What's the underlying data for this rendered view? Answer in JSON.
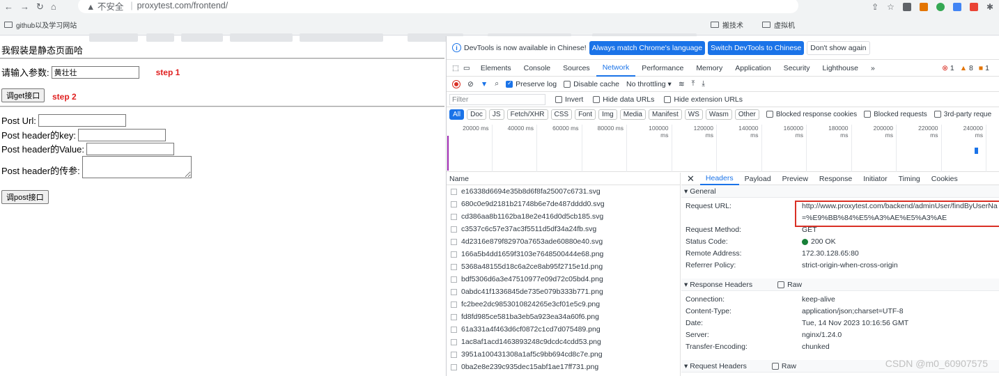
{
  "browser": {
    "address": {
      "security_label": "▲ 不安全",
      "url": "proxytest.com/frontend/"
    },
    "bookmarks": [
      {
        "label": "github以及学习网站"
      },
      {
        "label": "搬技术"
      },
      {
        "label": "虚拟机"
      }
    ]
  },
  "page": {
    "title": "我假装是静态页面哈",
    "param_label": "请输入参数:",
    "param_value": "黄壮壮",
    "step1": "step 1",
    "get_button": "调get接口",
    "step2": "step 2",
    "post_url_label": "Post Url:",
    "post_key_label": "Post header的key:",
    "post_value_label": "Post header的Value:",
    "post_param_label": "Post header的传参:",
    "post_button": "调post接口"
  },
  "devtools": {
    "infobar": {
      "text": "DevTools is now available in Chinese!",
      "btn_match": "Always match Chrome's language",
      "btn_switch": "Switch DevTools to Chinese",
      "btn_dismiss": "Don't show again"
    },
    "tabs": [
      "Elements",
      "Console",
      "Sources",
      "Network",
      "Performance",
      "Memory",
      "Application",
      "Security",
      "Lighthouse"
    ],
    "more_tabs": "»",
    "counts": {
      "errors": "1",
      "warnings": "8",
      "issues": "1"
    },
    "network_bar": {
      "preserve_log": "Preserve log",
      "disable_cache": "Disable cache",
      "throttling": "No throttling"
    },
    "filter": {
      "placeholder": "Filter",
      "invert": "Invert",
      "hide_data": "Hide data URLs",
      "hide_ext": "Hide extension URLs"
    },
    "types": [
      "All",
      "Doc",
      "JS",
      "Fetch/XHR",
      "CSS",
      "Font",
      "Img",
      "Media",
      "Manifest",
      "WS",
      "Wasm",
      "Other"
    ],
    "type_filters": [
      "Blocked response cookies",
      "Blocked requests",
      "3rd-party reque"
    ],
    "timeline_ticks": [
      "20000 ms",
      "40000 ms",
      "60000 ms",
      "80000 ms",
      "100000 ms",
      "120000 ms",
      "140000 ms",
      "160000 ms",
      "180000 ms",
      "200000 ms",
      "220000 ms",
      "240000 ms"
    ],
    "name_header": "Name",
    "files": [
      "e16338d6694e35b8d6f8fa25007c6731.svg",
      "680c0e9d2181b21748b6e7de487dddd0.svg",
      "cd386aa8b1162ba18e2e416d0d5cb185.svg",
      "c3537c6c57e37ac3f5511d5df34a24fb.svg",
      "4d2316e879f82970a7653ade60880e40.svg",
      "166a5b4dd1659f3103e7648500444e68.png",
      "5368a48155d18c6a2ce8ab95f2715e1d.png",
      "bdf5306d6a3e47510977e09d72c05bd4.png",
      "0abdc41f1336845de735e079b333b771.png",
      "fc2bee2dc9853010824265e3cf01e5c9.png",
      "fd8fd985ce581ba3eb5a923ea34a60f6.png",
      "61a331a4f463d6cf0872c1cd7d075489.png",
      "1ac8af1acd1463893248c9dcdc4cdd53.png",
      "3951a100431308a1af5c9bb694cd8c7e.png",
      "0ba2e8e239c935dec15abf1ae17ff731.png"
    ],
    "detail_tabs": [
      "Headers",
      "Payload",
      "Preview",
      "Response",
      "Initiator",
      "Timing",
      "Cookies"
    ],
    "general_title": "▾ General",
    "general": {
      "request_url_key": "Request URL:",
      "request_url_1": "http://www.proxytest.com/backend/adminUser/findByUserNa",
      "request_url_2": "=%E9%BB%84%E5%A3%AE%E5%A3%AE",
      "method_key": "Request Method:",
      "method": "GET",
      "status_key": "Status Code:",
      "status": "200 OK",
      "remote_key": "Remote Address:",
      "remote": "172.30.128.65:80",
      "referrer_key": "Referrer Policy:",
      "referrer": "strict-origin-when-cross-origin"
    },
    "response_headers_title": "▾ Response Headers",
    "raw_label": "Raw",
    "response_headers": [
      {
        "k": "Connection:",
        "v": "keep-alive"
      },
      {
        "k": "Content-Type:",
        "v": "application/json;charset=UTF-8"
      },
      {
        "k": "Date:",
        "v": "Tue, 14 Nov 2023 10:16:56 GMT"
      },
      {
        "k": "Server:",
        "v": "nginx/1.24.0"
      },
      {
        "k": "Transfer-Encoding:",
        "v": "chunked"
      }
    ],
    "request_headers_title": "▾ Request Headers"
  },
  "watermark": "CSDN @m0_60907575"
}
